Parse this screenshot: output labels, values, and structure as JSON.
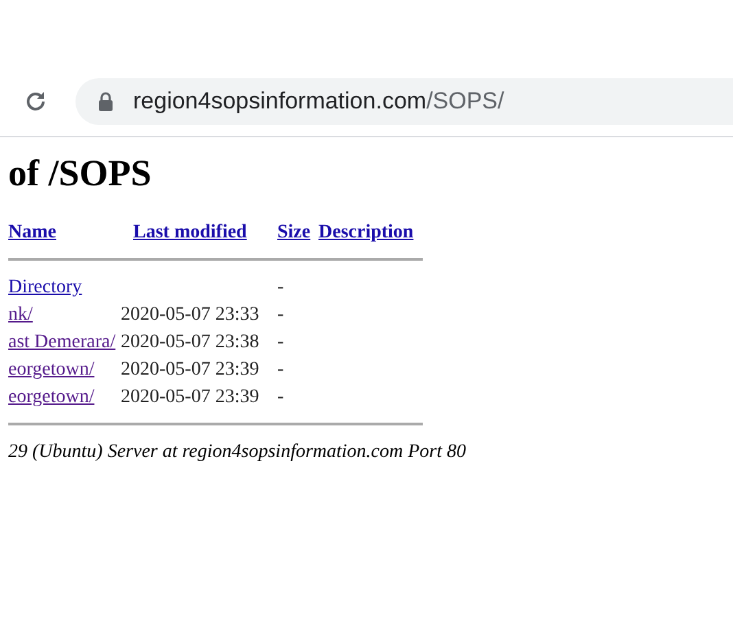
{
  "address_bar": {
    "host": "region4sopsinformation.com",
    "path": "/SOPS/"
  },
  "heading": "of /SOPS",
  "table": {
    "columns": [
      "Name",
      "Last modified",
      "Size",
      "Description"
    ],
    "rows": [
      {
        "name": "Directory",
        "visited": false,
        "modified": "",
        "size": "-"
      },
      {
        "name": "nk/",
        "visited": true,
        "modified": "2020-05-07 23:33",
        "size": "-"
      },
      {
        "name": "ast Demerara/",
        "visited": true,
        "modified": "2020-05-07 23:38",
        "size": "-"
      },
      {
        "name": "eorgetown/",
        "visited": true,
        "modified": "2020-05-07 23:39",
        "size": "-"
      },
      {
        "name": "eorgetown/",
        "visited": true,
        "modified": "2020-05-07 23:39",
        "size": "-"
      }
    ]
  },
  "footer": "29 (Ubuntu) Server at region4sopsinformation.com Port 80"
}
